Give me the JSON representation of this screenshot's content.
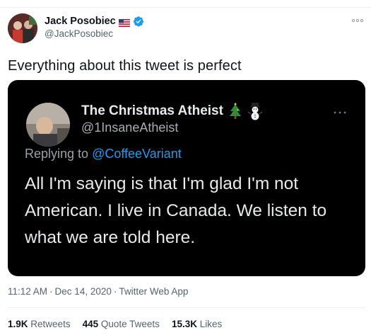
{
  "author": {
    "name": "Jack Posobiec",
    "handle": "@JackPosobiec"
  },
  "tweet": {
    "text": "Everything about this tweet is perfect",
    "time": "11:12 AM",
    "date": "Dec 14, 2020",
    "source": "Twitter Web App",
    "separator": "·"
  },
  "embedded": {
    "name": "The Christmas Atheist",
    "handle": "@1InsaneAtheist",
    "replying_prefix": "Replying to",
    "replying_to": "@CoffeeVariant",
    "body": "All I'm saying is that I'm glad I'm not American. I live in Canada. We listen to what we are told here."
  },
  "stats": {
    "retweets_count": "1.9K",
    "retweets_label": "Retweets",
    "quotes_count": "445",
    "quotes_label": "Quote Tweets",
    "likes_count": "15.3K",
    "likes_label": "Likes"
  },
  "colors": {
    "accent": "#1d9bf0",
    "text": "#0f1419",
    "secondary": "#536471",
    "media_bg": "#000000"
  },
  "icons": [
    "flag-us-icon",
    "verified-badge-icon",
    "more-options-icon",
    "christmas-tree-icon",
    "snowman-icon"
  ]
}
